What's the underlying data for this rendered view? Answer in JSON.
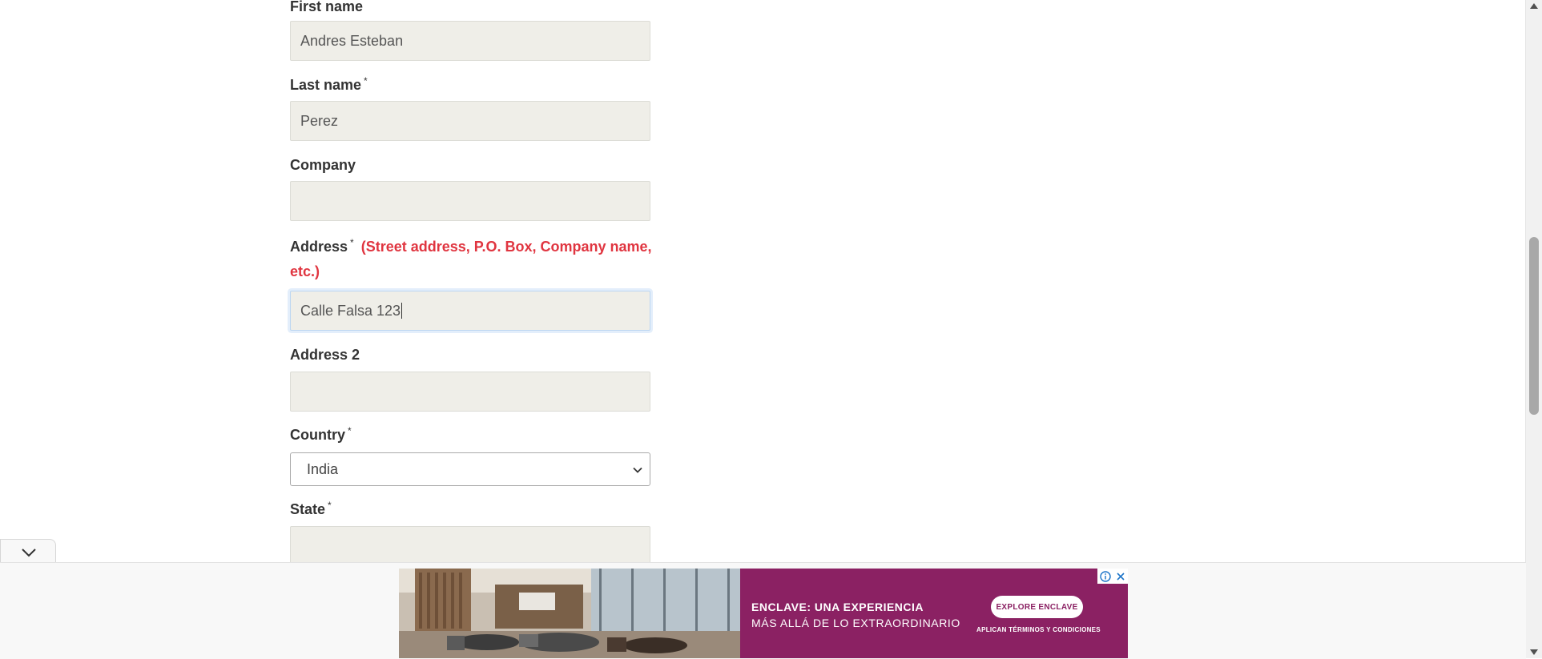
{
  "form": {
    "first_name": {
      "label": "First name",
      "value": "Andres Esteban"
    },
    "last_name": {
      "label": "Last name",
      "required": "*",
      "value": "Perez"
    },
    "company": {
      "label": "Company",
      "value": ""
    },
    "address": {
      "label": "Address",
      "required": "*",
      "hint": "(Street address, P.O. Box, Company name,",
      "hint2": "etc.)",
      "value": "Calle Falsa 123"
    },
    "address2": {
      "label": "Address 2",
      "value": ""
    },
    "country": {
      "label": "Country",
      "required": "*",
      "selected": "India"
    },
    "state": {
      "label": "State",
      "required": "*",
      "value": ""
    }
  },
  "ad": {
    "headline": "ENCLAVE: UNA EXPERIENCIA",
    "subline": "MÁS ALLÁ DE LO EXTRAORDINARIO",
    "cta": "EXPLORE ENCLAVE",
    "terms": "APLICAN TÉRMINOS Y CONDICIONES",
    "background_color": "#8b2163"
  },
  "colors": {
    "hint": "#e03540",
    "input_bg": "#efeee8"
  },
  "icons": [
    "chevron-down-icon",
    "info-icon",
    "close-icon",
    "scroll-up-arrow",
    "scroll-down-arrow"
  ]
}
